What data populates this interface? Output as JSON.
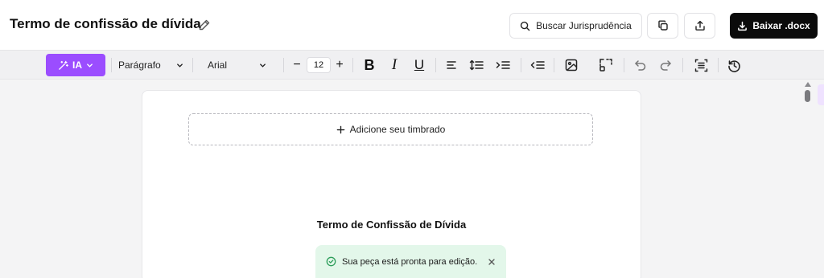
{
  "header": {
    "title": "Termo de confissão de dívida",
    "search_jurisprudence_label": "Buscar Jurisprudência",
    "download_label": "Baixar .docx"
  },
  "toolbar": {
    "ai_label": "IA",
    "block_type": "Parágrafo",
    "font_family": "Arial",
    "font_size": "12",
    "decrease_symbol": "−",
    "increase_symbol": "+",
    "bold_symbol": "B",
    "italic_symbol": "I",
    "underline_symbol": "U"
  },
  "document": {
    "letterhead_label": "Adicione seu timbrado",
    "heading": "Termo de Confissão de Dívida"
  },
  "toast": {
    "message": "Sua peça está pronta para edição."
  },
  "colors": {
    "accent": "#9b4dff",
    "download_bg": "#0b0b0b",
    "toast_bg": "#e3f7ea",
    "success": "#2e9e5b"
  },
  "icons": [
    "pencil-icon",
    "search-icon",
    "copy-icon",
    "share-icon",
    "download-icon",
    "magic-wand-icon",
    "chevron-down-icon",
    "align-left-icon",
    "line-height-icon",
    "indent-icon",
    "outdent-icon",
    "image-icon",
    "select-area-icon",
    "undo-icon",
    "redo-icon",
    "page-layout-icon",
    "history-icon",
    "plus-icon",
    "check-circle-icon",
    "close-icon"
  ]
}
